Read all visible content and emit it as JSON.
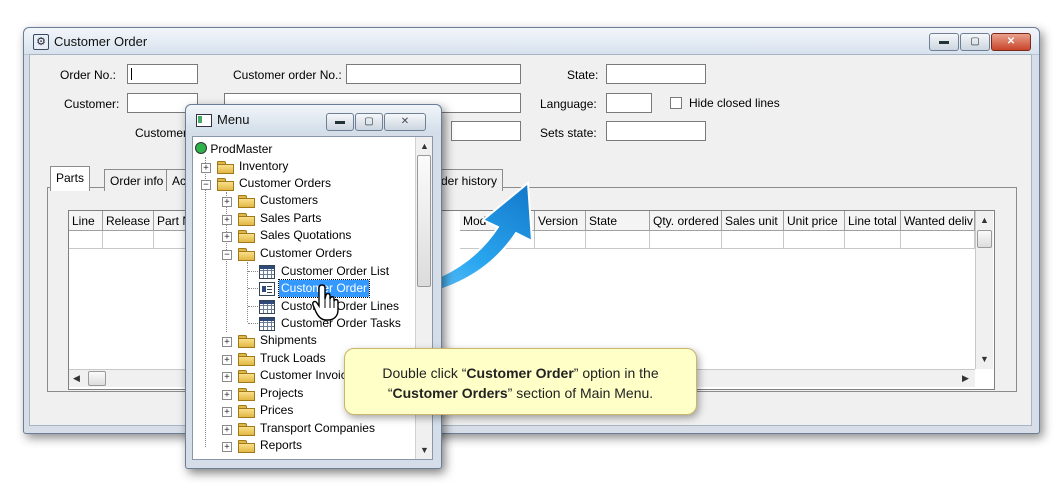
{
  "main_window": {
    "title": "Customer Order",
    "fields": {
      "order_no_label": "Order No.:",
      "customer_order_no_label": "Customer order No.:",
      "state_label": "State:",
      "customer_label": "Customer:",
      "language_label": "Language:",
      "hide_closed_lines_label": "Hide closed lines",
      "customer_partial_label": "Customer",
      "sets_state_label": "Sets state:"
    },
    "tabs": [
      "Parts",
      "Order info",
      "Ac",
      "der history"
    ],
    "grid_columns": [
      "Line",
      "Release",
      "Part N",
      "Mod",
      "Version",
      "State",
      "Qty. ordered",
      "Sales unit",
      "Unit price",
      "Line total",
      "Wanted deliv"
    ]
  },
  "menu_window": {
    "title": "Menu",
    "tree": {
      "root": "ProdMaster",
      "inventory": "Inventory",
      "customer_orders": "Customer Orders",
      "customers": "Customers",
      "sales_parts": "Sales Parts",
      "sales_quotations": "Sales Quotations",
      "customer_orders_sub": "Customer Orders",
      "customer_order_list": "Customer Order List",
      "customer_order": "Customer Order",
      "customer_order_lines": "Customer Order Lines",
      "customer_order_tasks": "Customer Order Tasks",
      "shipments": "Shipments",
      "truck_loads": "Truck Loads",
      "customer_invoices": "Customer Invoice",
      "projects": "Projects",
      "prices": "Prices",
      "transport_companies": "Transport Companies",
      "reports": "Reports"
    }
  },
  "callout": {
    "part1": "Double click “",
    "bold1": "Customer Order",
    "part2": "” option in the",
    "part3": "“",
    "bold2": "Customer Orders",
    "part4": "” section of Main Menu."
  },
  "colors": {
    "selection": "#3399ff",
    "callout_bg": "#ffffc8",
    "arrow": "#1e9be8"
  },
  "icons": [
    "app-icon",
    "menu-window-icon",
    "minimize-icon",
    "maximize-icon",
    "close-icon",
    "folder-icon",
    "grid-list-icon",
    "form-icon",
    "hand-cursor-icon",
    "curved-arrow-icon"
  ]
}
